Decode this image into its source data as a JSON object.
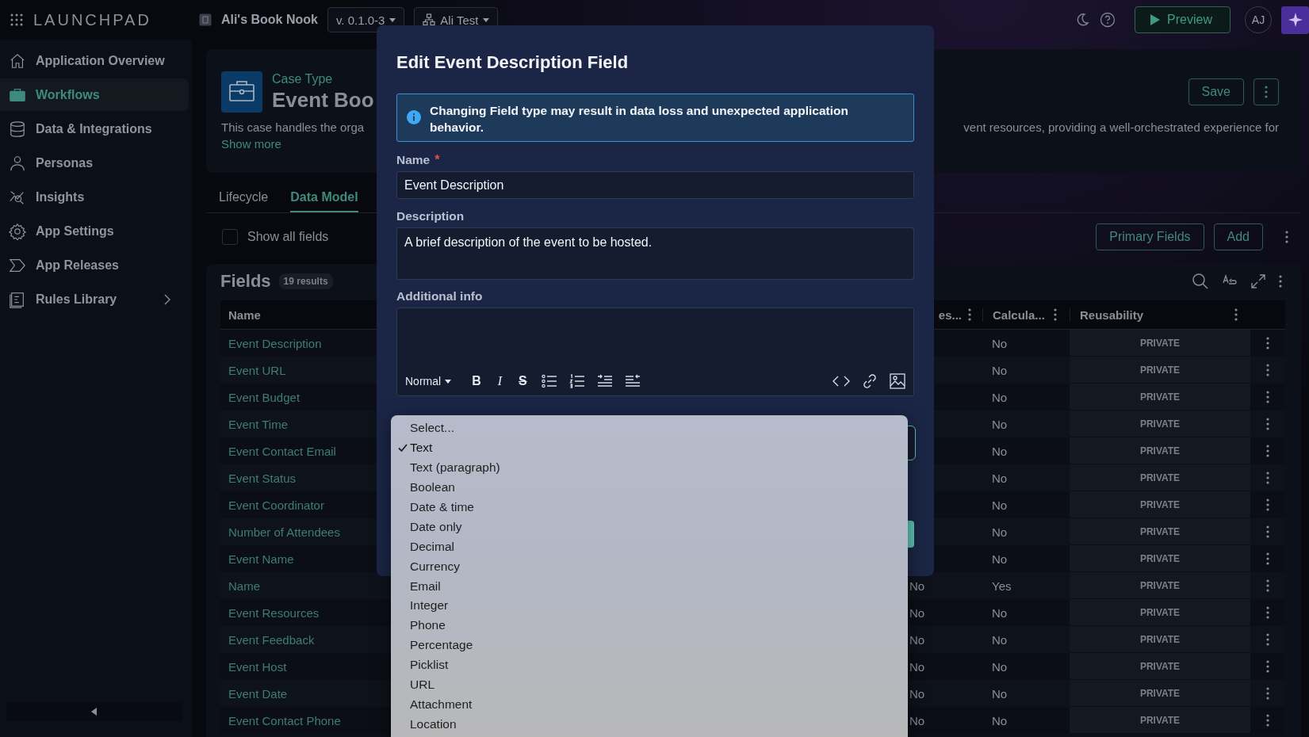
{
  "top_bar": {
    "logo": "LAUNCHPAD",
    "app_name": "Ali's Book Nook",
    "version": "v. 0.1.0-3",
    "environment": "Ali Test",
    "preview_button": "Preview",
    "avatar": "AJ"
  },
  "sidebar": {
    "items": [
      {
        "label": "Application Overview",
        "selected": false,
        "expandable": false
      },
      {
        "label": "Workflows",
        "selected": true,
        "expandable": false
      },
      {
        "label": "Data & Integrations",
        "selected": false,
        "expandable": false
      },
      {
        "label": "Personas",
        "selected": false,
        "expandable": false
      },
      {
        "label": "Insights",
        "selected": false,
        "expandable": false
      },
      {
        "label": "App Settings",
        "selected": false,
        "expandable": false
      },
      {
        "label": "App Releases",
        "selected": false,
        "expandable": false
      },
      {
        "label": "Rules Library",
        "selected": false,
        "expandable": true
      }
    ]
  },
  "header": {
    "label": "Case Type",
    "title": "Event Boo",
    "description_left": "This case handles the orga",
    "description_right": "vent resources, providing a well-orchestrated experience for",
    "show_more": "Show more",
    "save_button": "Save"
  },
  "tabs": [
    {
      "label": "Lifecycle",
      "selected": false
    },
    {
      "label": "Data Model",
      "selected": true
    }
  ],
  "show_all_fields": {
    "label": "Show all fields",
    "checked": false
  },
  "actions": {
    "primary_fields": "Primary Fields",
    "add": "Add"
  },
  "fields": {
    "title": "Fields",
    "count": "19 results",
    "columns": {
      "name": "Name",
      "column_2": "es...",
      "calculated": "Calcula...",
      "reusability": "Reusability"
    },
    "rows": [
      {
        "name": "Event Description",
        "calculated": "No",
        "reusability": "PRIVATE"
      },
      {
        "name": "Event URL",
        "calculated": "No",
        "reusability": "PRIVATE"
      },
      {
        "name": "Event Budget",
        "calculated": "No",
        "reusability": "PRIVATE"
      },
      {
        "name": "Event Time",
        "calculated": "No",
        "reusability": "PRIVATE"
      },
      {
        "name": "Event Contact Email",
        "calculated": "No",
        "reusability": "PRIVATE"
      },
      {
        "name": "Event Status",
        "calculated": "No",
        "reusability": "PRIVATE"
      },
      {
        "name": "Event Coordinator",
        "calculated": "No",
        "reusability": "PRIVATE"
      },
      {
        "name": "Number of Attendees",
        "calculated": "No",
        "reusability": "PRIVATE"
      },
      {
        "name": "Event Name",
        "calculated": "No",
        "reusability": "PRIVATE"
      },
      {
        "name": "Name",
        "column_2": "No",
        "calculated": "Yes",
        "reusability": "PRIVATE"
      },
      {
        "name": "Event Resources",
        "column_2": "No",
        "calculated": "No",
        "reusability": "PRIVATE"
      },
      {
        "name": "Event Feedback",
        "column_2": "No",
        "calculated": "No",
        "reusability": "PRIVATE"
      },
      {
        "name": "Event Host",
        "column_2": "No",
        "calculated": "No",
        "reusability": "PRIVATE"
      },
      {
        "name": "Event Date",
        "column_2": "No",
        "calculated": "No",
        "reusability": "PRIVATE"
      },
      {
        "name": "Event Contact Phone",
        "column_2": "No",
        "calculated": "No",
        "reusability": "PRIVATE"
      }
    ]
  },
  "modal": {
    "title": "Edit Event Description Field",
    "alert": "Changing Field type may result in data loss and unexpected application behavior.",
    "name_label": "Name",
    "required_mark": "*",
    "name_value": "Event Description",
    "description_label": "Description",
    "description_value": "A brief description of the event to be hosted.",
    "additional_info_label": "Additional info",
    "format": "Normal",
    "format_buttons": [
      {
        "label": "B",
        "kind": "bold"
      },
      {
        "label": "I",
        "kind": "italic"
      },
      {
        "label": "S",
        "kind": "strike"
      }
    ]
  },
  "type_dropdown": {
    "options": [
      {
        "label": "Select...",
        "selected": false
      },
      {
        "label": "Text",
        "selected": true
      },
      {
        "label": "Text (paragraph)",
        "selected": false
      },
      {
        "label": "Boolean",
        "selected": false
      },
      {
        "label": "Date & time",
        "selected": false
      },
      {
        "label": "Date only",
        "selected": false
      },
      {
        "label": "Decimal",
        "selected": false
      },
      {
        "label": "Currency",
        "selected": false
      },
      {
        "label": "Email",
        "selected": false
      },
      {
        "label": "Integer",
        "selected": false
      },
      {
        "label": "Phone",
        "selected": false
      },
      {
        "label": "Percentage",
        "selected": false
      },
      {
        "label": "Picklist",
        "selected": false
      },
      {
        "label": "URL",
        "selected": false
      },
      {
        "label": "Attachment",
        "selected": false
      },
      {
        "label": "Location",
        "selected": false
      }
    ]
  }
}
